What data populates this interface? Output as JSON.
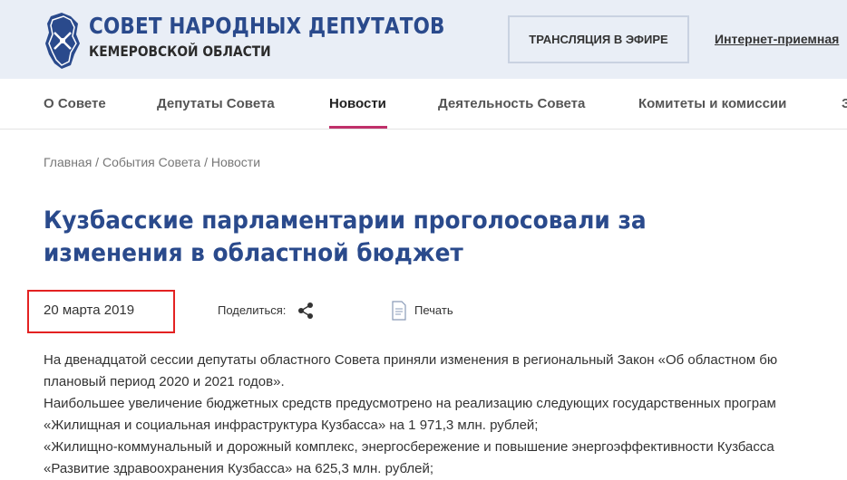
{
  "header": {
    "org_title": "СОВЕТ НАРОДНЫХ ДЕПУТАТОВ",
    "org_subtitle": "КЕМЕРОВСКОЙ ОБЛАСТИ",
    "live_button": "ТРАНСЛЯЦИЯ В ЭФИРЕ",
    "reception_link": "Интернет-приемная",
    "colors": {
      "brand": "#2a4a8c",
      "header_bg": "#e9eef6",
      "accent": "#c0306a",
      "highlight": "#e32222"
    }
  },
  "nav": {
    "items": [
      {
        "label": "О Совете"
      },
      {
        "label": "Депутаты Совета"
      },
      {
        "label": "Новости",
        "active": true
      },
      {
        "label": "Деятельность Совета"
      },
      {
        "label": "Комитеты и комиссии"
      },
      {
        "label": "З"
      }
    ]
  },
  "breadcrumb": {
    "text": "Главная / События Совета / Новости"
  },
  "article": {
    "title": "Кузбасские парламентарии проголосовали за изменения в областной бюджет",
    "date": "20 марта 2019",
    "share_label": "Поделиться:",
    "share_icon": "share-icon",
    "print_label": "Печать",
    "print_icon": "print-icon",
    "paragraphs": [
      "На двенадцатой сессии депутаты областного Совета приняли изменения в региональный Закон «Об областном бю",
      "плановый период 2020 и 2021 годов».",
      "Наибольшее увеличение бюджетных средств предусмотрено на реализацию следующих государственных програм",
      "«Жилищная и социальная инфраструктура Кузбасса» на 1 971,3 млн. рублей;",
      "«Жилищно-коммунальный и дорожный комплекс, энергосбережение и повышение энергоэффективности Кузбасса",
      "«Развитие здравоохранения Кузбасса» на 625,3 млн. рублей;"
    ]
  }
}
